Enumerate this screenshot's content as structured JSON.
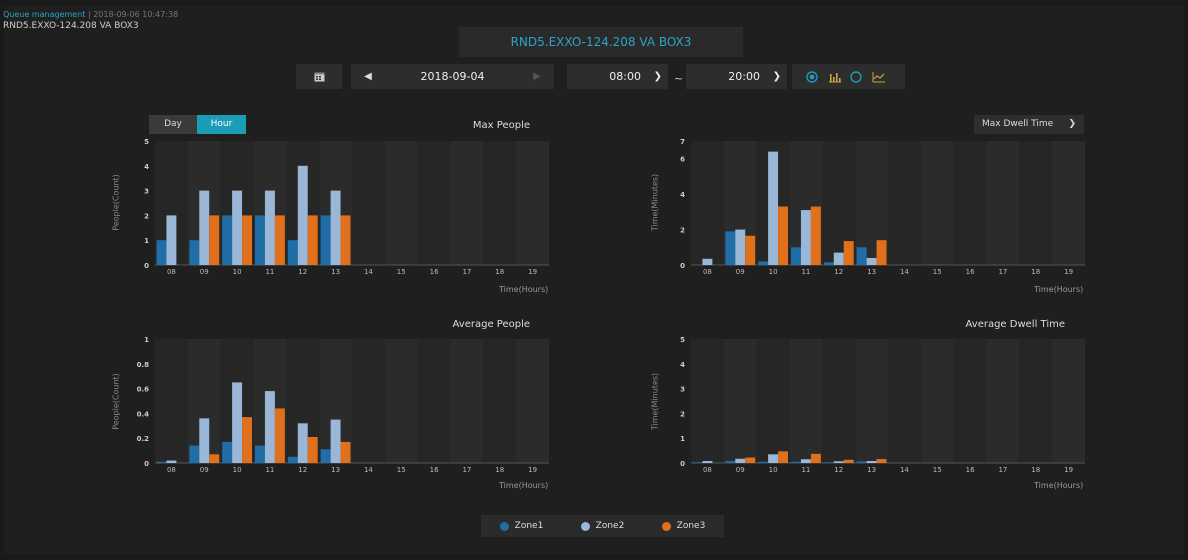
{
  "header": {
    "breadcrumb_link": "Queue management",
    "breadcrumb_rest": " | 2018-09-06 10:47:38",
    "device_name": "RND5.EXXO-124.208  VA BOX3",
    "center_title": "RND5.EXXO-124.208 VA BOX3"
  },
  "toolbar": {
    "date": "2018-09-04",
    "start_time": "08:00",
    "end_time": "20:00",
    "range_separator": "~",
    "icons": [
      "calendar-icon",
      "prev-arrow-icon",
      "next-arrow-icon",
      "chevron-down-icon",
      "radio-selected-icon",
      "bar-chart-icon",
      "radio-icon",
      "line-chart-icon"
    ]
  },
  "controls": {
    "day_label": "Day",
    "hour_label": "Hour",
    "dwell_select_label": "Max Dwell Time"
  },
  "colors": {
    "zone1": "#1f6ea7",
    "zone2": "#9ab7d8",
    "zone3": "#e1701c",
    "accent": "#1b9db7"
  },
  "legend": [
    {
      "label": "Zone1",
      "color": "#1f6ea7"
    },
    {
      "label": "Zone2",
      "color": "#9ab7d8"
    },
    {
      "label": "Zone3",
      "color": "#e1701c"
    }
  ],
  "chart_data": [
    {
      "type": "bar",
      "title": "Max People",
      "ylabel": "People(Count)",
      "xlabel": "Time(Hours)",
      "ylim": [
        0,
        5
      ],
      "yticks": [
        "0",
        "1",
        "2",
        "3",
        "4",
        "5"
      ],
      "categories": [
        "08",
        "09",
        "10",
        "11",
        "12",
        "13",
        "14",
        "15",
        "16",
        "17",
        "18",
        "19"
      ],
      "series": [
        {
          "name": "Zone1",
          "values": [
            1,
            1,
            2,
            2,
            1,
            2,
            0,
            0,
            0,
            0,
            0,
            0
          ]
        },
        {
          "name": "Zone2",
          "values": [
            2,
            3,
            3,
            3,
            4,
            3,
            0,
            0,
            0,
            0,
            0,
            0
          ]
        },
        {
          "name": "Zone3",
          "values": [
            0,
            2,
            2,
            2,
            2,
            2,
            0,
            0,
            0,
            0,
            0,
            0
          ]
        }
      ]
    },
    {
      "type": "bar",
      "title": "",
      "ylabel": "Time(Minutes)",
      "xlabel": "Time(Hours)",
      "ylim": [
        0,
        7
      ],
      "yticks": [
        "0",
        "2",
        "4",
        "6",
        "7"
      ],
      "categories": [
        "08",
        "09",
        "10",
        "11",
        "12",
        "13",
        "14",
        "15",
        "16",
        "17",
        "18",
        "19"
      ],
      "series": [
        {
          "name": "Zone1",
          "values": [
            0,
            1.9,
            0.2,
            1.0,
            0.15,
            1.0,
            0,
            0,
            0,
            0,
            0,
            0
          ]
        },
        {
          "name": "Zone2",
          "values": [
            0.35,
            2.0,
            6.4,
            3.1,
            0.7,
            0.4,
            0,
            0,
            0,
            0,
            0,
            0
          ]
        },
        {
          "name": "Zone3",
          "values": [
            0,
            1.65,
            3.3,
            3.3,
            1.35,
            1.4,
            0,
            0,
            0,
            0,
            0,
            0
          ]
        }
      ]
    },
    {
      "type": "bar",
      "title": "Average People",
      "ylabel": "People(Count)",
      "xlabel": "Time(Hours)",
      "ylim": [
        0,
        1
      ],
      "yticks": [
        "0",
        "0.2",
        "0.4",
        "0.6",
        "0.8",
        "1"
      ],
      "categories": [
        "08",
        "09",
        "10",
        "11",
        "12",
        "13",
        "14",
        "15",
        "16",
        "17",
        "18",
        "19"
      ],
      "series": [
        {
          "name": "Zone1",
          "values": [
            0.01,
            0.14,
            0.17,
            0.14,
            0.05,
            0.11,
            0,
            0,
            0,
            0,
            0,
            0
          ]
        },
        {
          "name": "Zone2",
          "values": [
            0.02,
            0.36,
            0.65,
            0.58,
            0.32,
            0.35,
            0,
            0,
            0,
            0,
            0,
            0
          ]
        },
        {
          "name": "Zone3",
          "values": [
            0,
            0.07,
            0.37,
            0.44,
            0.21,
            0.17,
            0,
            0,
            0,
            0,
            0,
            0
          ]
        }
      ]
    },
    {
      "type": "bar",
      "title": "Average Dwell Time",
      "ylabel": "Time(Minutes)",
      "xlabel": "Time(Hours)",
      "ylim": [
        0,
        5
      ],
      "yticks": [
        "0",
        "1",
        "2",
        "3",
        "4",
        "5"
      ],
      "categories": [
        "08",
        "09",
        "10",
        "11",
        "12",
        "13",
        "14",
        "15",
        "16",
        "17",
        "18",
        "19"
      ],
      "series": [
        {
          "name": "Zone1",
          "values": [
            0.03,
            0.08,
            0.05,
            0.05,
            0.03,
            0.06,
            0,
            0,
            0,
            0,
            0,
            0
          ]
        },
        {
          "name": "Zone2",
          "values": [
            0.08,
            0.17,
            0.35,
            0.15,
            0.07,
            0.08,
            0,
            0,
            0,
            0,
            0,
            0
          ]
        },
        {
          "name": "Zone3",
          "values": [
            0,
            0.22,
            0.47,
            0.37,
            0.13,
            0.16,
            0,
            0,
            0,
            0,
            0,
            0
          ]
        }
      ]
    }
  ]
}
